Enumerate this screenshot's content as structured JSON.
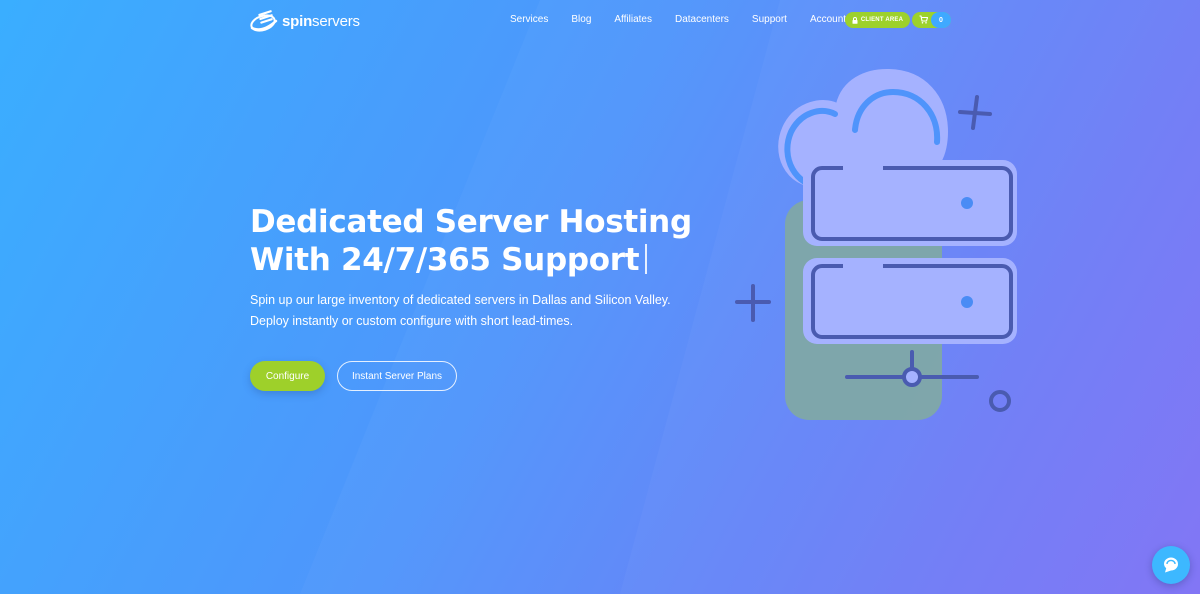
{
  "brand": {
    "name_bold": "spin",
    "name_rest": "servers",
    "logo_icon": "spin-logo-icon"
  },
  "nav": {
    "items": [
      "Services",
      "Blog",
      "Affiliates",
      "Datacenters",
      "Support",
      "Account"
    ],
    "client_area_label": "CLIENT AREA",
    "cart_count": "0"
  },
  "hero": {
    "title_line1": "Dedicated Server Hosting",
    "title_line2": "With 24/7/365 Support",
    "desc_line1": "Spin up our large inventory of dedicated servers in Dallas and Silicon Valley.",
    "desc_line2": "Deploy instantly or custom configure with short lead-times.",
    "configure_label": "Configure",
    "plans_label": "Instant Server Plans"
  },
  "colors": {
    "accent_green": "#9ed02a",
    "accent_blue": "#3fa9ff",
    "illustration_stroke": "#4a5bb0",
    "illustration_fill": "#a5b2ff"
  },
  "icons": [
    "spin-logo-icon",
    "lock-icon",
    "cart-icon",
    "cloud-icon",
    "server-icon",
    "plus-icon",
    "chat-icon"
  ]
}
